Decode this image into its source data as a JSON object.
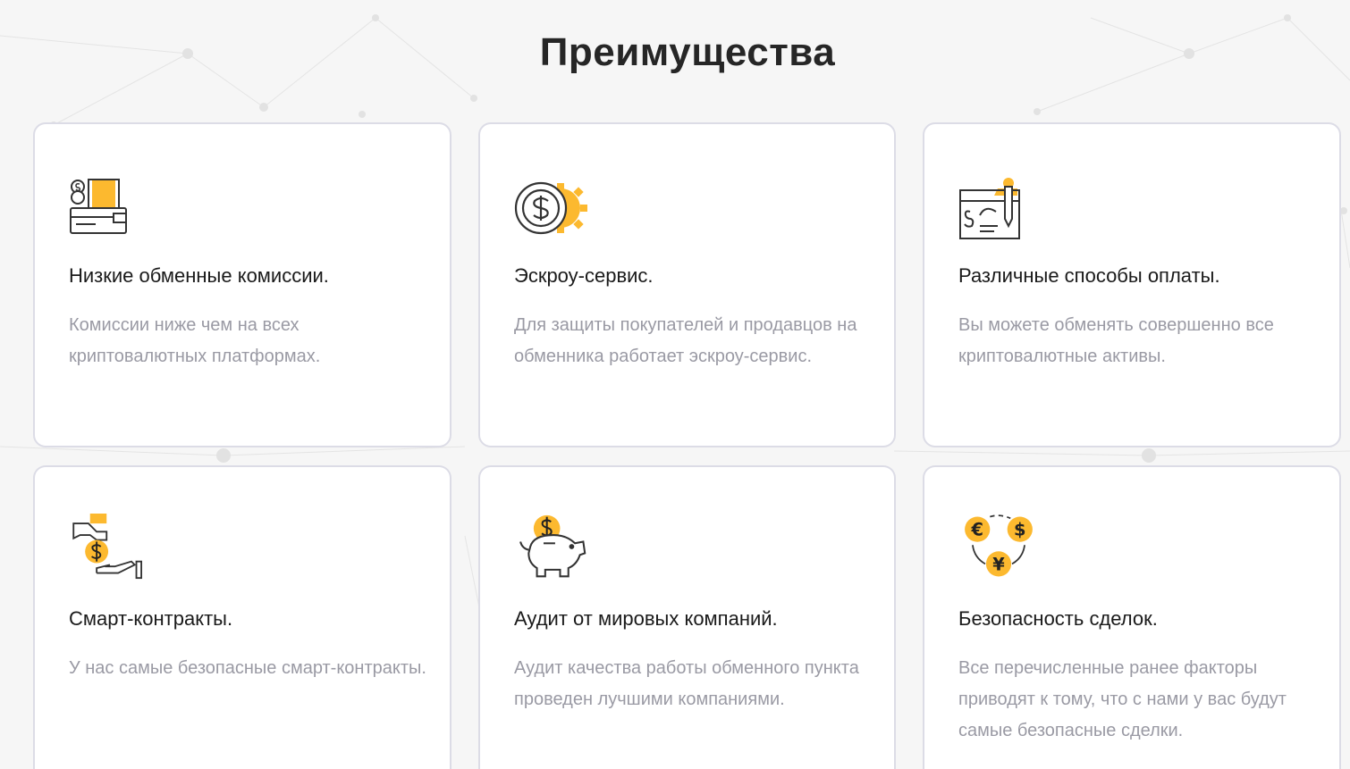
{
  "section": {
    "title": "Преимущества"
  },
  "colors": {
    "accent": "#fcb92f",
    "icon_stroke": "#333333",
    "card_border": "#dcdce6",
    "muted_text": "#9a9aa4"
  },
  "cards": [
    {
      "icon": "wallet-coins-icon",
      "title": "Низкие обменные комиссии.",
      "text": "Комиссии ниже чем на всех криптовалютных платформах."
    },
    {
      "icon": "coin-gear-icon",
      "title": "Эскроу-сервис.",
      "text": "Для защиты покупателей и продавцов на обменника работает эскроу-сервис."
    },
    {
      "icon": "check-pen-icon",
      "title": "Различные способы оплаты.",
      "text": "Вы можете обменять совершенно все криптовалютные активы."
    },
    {
      "icon": "hand-coin-icon",
      "title": "Смарт-контракты.",
      "text": "У нас самые безопасные смарт-контракты."
    },
    {
      "icon": "piggy-bank-icon",
      "title": "Аудит от мировых компаний.",
      "text": "Аудит качества работы обменного пункта проведен лучшими компаниями."
    },
    {
      "icon": "currency-exchange-icon",
      "title": "Безопасность сделок.",
      "text": "Все перечисленные ранее факторы приводят к тому, что с нами у вас будут самые безопасные сделки."
    }
  ]
}
